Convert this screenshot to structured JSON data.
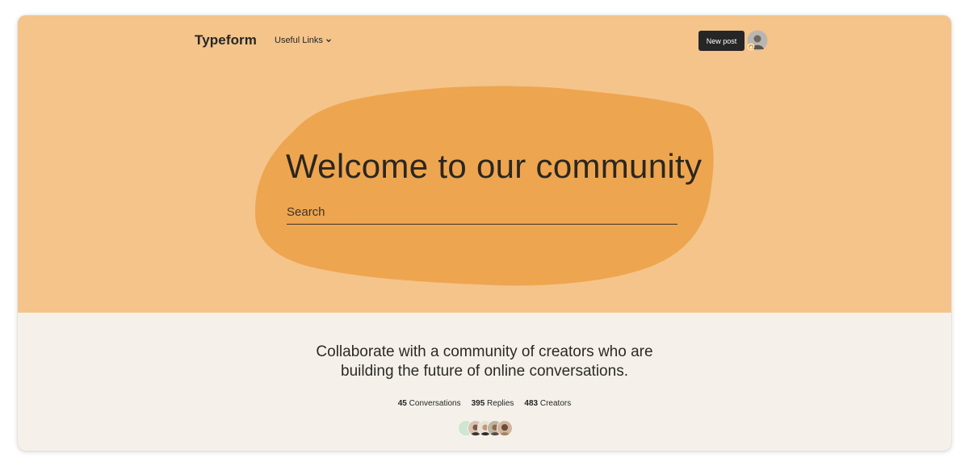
{
  "nav": {
    "logo": "Typeform",
    "useful_links": "Useful Links",
    "new_post": "New post"
  },
  "hero": {
    "title": "Welcome to our community",
    "search_placeholder": "Search"
  },
  "intro": {
    "line1": "Collaborate with a community of creators who are",
    "line2": "building the future of online conversations."
  },
  "stats": [
    {
      "count": "45",
      "label": "Conversations"
    },
    {
      "count": "395",
      "label": "Replies"
    },
    {
      "count": "483",
      "label": "Creators"
    }
  ],
  "colors": {
    "hero_bg": "#f4c48a",
    "blob": "#eea54f",
    "page_bg": "#f5f1ea",
    "dark": "#262627"
  },
  "icons": {
    "chevron": "chevron-down-icon",
    "user_avatar": "user-avatar-icon",
    "badge": "orange-badge-icon"
  }
}
